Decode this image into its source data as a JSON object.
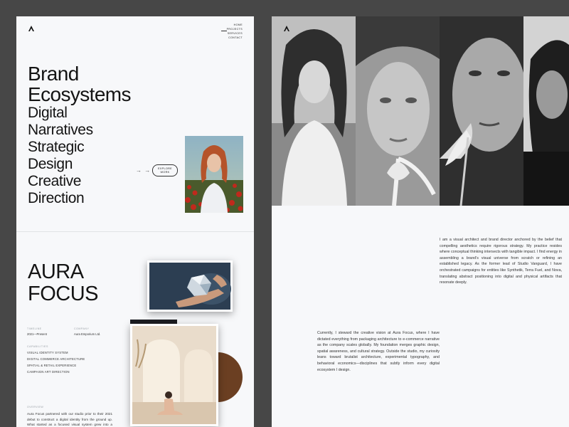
{
  "colors": {
    "backdrop": "#474747",
    "panel": "#f7f8fa",
    "ink": "#141414",
    "muted": "#9aa0a6"
  },
  "brand": {
    "logo_icon": "caret-up-logo-icon"
  },
  "nav": {
    "items": [
      "HOME",
      "PROJECTS",
      "SERVICES",
      "CONTACT"
    ]
  },
  "hero": {
    "title": "Brand Ecosystems",
    "lines": [
      "Digital",
      "Narratives",
      "Strategic",
      "Design",
      "Creative",
      "Direction"
    ],
    "arrows": "→ →",
    "cta": "EXPLORE WORK"
  },
  "project": {
    "title_line1": "AURA",
    "title_line2": "FOCUS",
    "timeline_label": "TIMELINE",
    "timeline_value": "2021—Present",
    "company_label": "COMPANY",
    "company_value": "Aura Emporium Ltd.",
    "capabilities_label": "CAPABILITIES",
    "capabilities": [
      "VISUAL IDENTITY SYSTEM",
      "DIGITAL COMMERCE ARCHITECTURE",
      "SPATIAL & RETAIL EXPERIENCE",
      "CAMPAIGN ART DIRECTION"
    ],
    "overview_label": "OVERVIEW",
    "overview_text": "Aura Focus partnered with our studio prior to their 2021 debut to construct a digital identity from the ground up. What started as a focused visual system grew into a comprehensive creative alliance spanning spatial design, campaign direction, and ecommerce brand"
  },
  "about": {
    "paragraph1": "I am a visual architect and brand director anchored by the belief that compelling aesthetics require rigorous strategy. My practice resides where conceptual thinking intersects with tangible impact. I find energy in assembling a brand's visual universe from scratch or refining an established legacy. As the former lead of Studio Vanguard, I have orchestrated campaigns for entities like Synthetik, Terra Fuel, and Nova, translating abstract positioning into digital and physical artifacts that resonate deeply.",
    "paragraph2": "Currently, I steward the creative vision at Aura Focus, where I have dictated everything from packaging architecture to e-commerce narrative as the company scales globally. My foundation merges graphic design, spatial awareness, and cultural strategy. Outside the studio, my curiosity leans toward brutalist architecture, experimental typography, and behavioral economics—disciplines that subtly inform every digital ecosystem I design."
  }
}
